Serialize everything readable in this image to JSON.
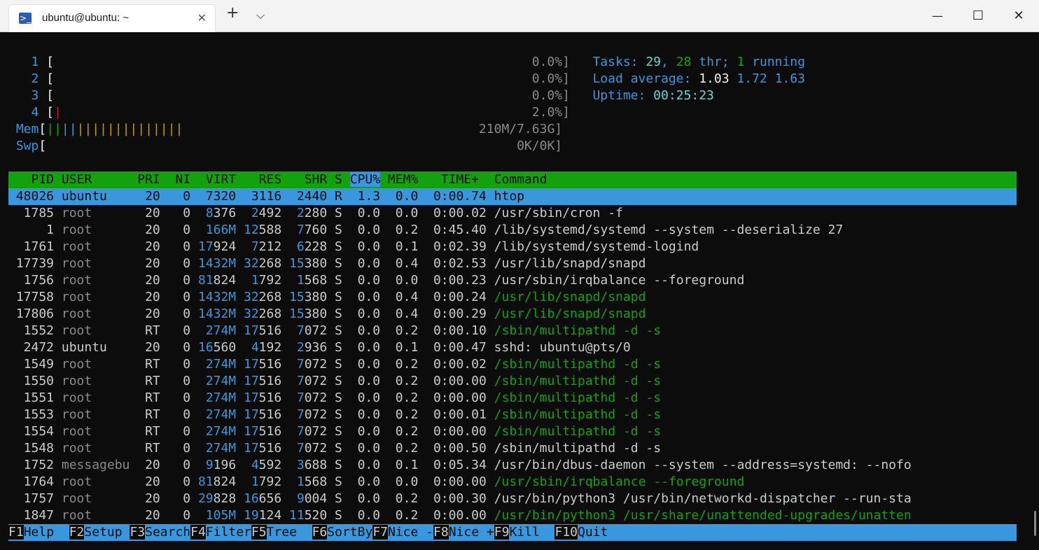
{
  "window": {
    "tab_title": "ubuntu@ubuntu: ~",
    "tab_icon": "powershell-icon",
    "new_tab": "+",
    "dropdown": "⌵",
    "close_tab": "✕",
    "minimize": "—",
    "maximize": "☐",
    "close": "✕"
  },
  "meters": {
    "cpu": [
      {
        "num": "1",
        "open": "[",
        "bar": "",
        "value": "0.0%]"
      },
      {
        "num": "2",
        "open": "[",
        "bar": "",
        "value": "0.0%]"
      },
      {
        "num": "3",
        "open": "[",
        "bar": "",
        "value": "0.0%]"
      },
      {
        "num": "4",
        "open": "[",
        "bar": "|",
        "value": "2.0%]"
      }
    ],
    "mem": {
      "label": "Mem",
      "open": "[",
      "bar_green": "||",
      "bar_blue": "||",
      "bar_yellow": "||||||||||||||",
      "value": "210M/7.63G]"
    },
    "swp": {
      "label": "Swp",
      "open": "[",
      "value": "0K/0K]"
    }
  },
  "summary": {
    "tasks_label": "Tasks:",
    "tasks_count": "29",
    "sep1": ",",
    "threads": "28",
    "thr_label": "thr;",
    "running": "1",
    "running_label": "running",
    "load_label": "Load average:",
    "load1": "1.03",
    "load5": "1.72",
    "load15": "1.63",
    "uptime_label": "Uptime:",
    "uptime": "00:25:23"
  },
  "header": {
    "pid": "  PID",
    "user": "USER     ",
    "pri": " PRI",
    "ni": "  NI",
    "virt": "  VIRT",
    "res": "   RES",
    "shr": "   SHR",
    "s": "S",
    "cpu": "CPU%",
    "mem": "MEM%",
    "time": "   TIME+ ",
    "command": "Command"
  },
  "processes": [
    {
      "pid": "48026",
      "user": "ubuntu",
      "pri": "20",
      "ni": "0",
      "virt": "7320",
      "res": "3116",
      "shr": "2440",
      "s": "R",
      "cpu": "1.3",
      "mem": "0.0",
      "time": "0:00.74",
      "cmd": "htop"
    },
    {
      "pid": "1785",
      "user": "root",
      "pri": "20",
      "ni": "0",
      "virt": "8376",
      "res": "2492",
      "shr": "2280",
      "s": "S",
      "cpu": "0.0",
      "mem": "0.0",
      "time": "0:00.02",
      "cmd": "/usr/sbin/cron -f"
    },
    {
      "pid": "1",
      "user": "root",
      "pri": "20",
      "ni": "0",
      "virt": "166M",
      "res": "12588",
      "shr": "7760",
      "s": "S",
      "cpu": "0.0",
      "mem": "0.2",
      "time": "0:45.40",
      "cmd": "/lib/systemd/systemd --system --deserialize 27"
    },
    {
      "pid": "1761",
      "user": "root",
      "pri": "20",
      "ni": "0",
      "virt": "17924",
      "res": "7212",
      "shr": "6228",
      "s": "S",
      "cpu": "0.0",
      "mem": "0.1",
      "time": "0:02.39",
      "cmd": "/lib/systemd/systemd-logind"
    },
    {
      "pid": "17739",
      "user": "root",
      "pri": "20",
      "ni": "0",
      "virt": "1432M",
      "res": "32268",
      "shr": "15380",
      "s": "S",
      "cpu": "0.0",
      "mem": "0.4",
      "time": "0:02.53",
      "cmd": "/usr/lib/snapd/snapd"
    },
    {
      "pid": "1756",
      "user": "root",
      "pri": "20",
      "ni": "0",
      "virt": "81824",
      "res": "1792",
      "shr": "1568",
      "s": "S",
      "cpu": "0.0",
      "mem": "0.0",
      "time": "0:00.23",
      "cmd": "/usr/sbin/irqbalance --foreground"
    },
    {
      "pid": "17758",
      "user": "root",
      "pri": "20",
      "ni": "0",
      "virt": "1432M",
      "res": "32268",
      "shr": "15380",
      "s": "S",
      "cpu": "0.0",
      "mem": "0.4",
      "time": "0:00.24",
      "cmd": "/usr/lib/snapd/snapd"
    },
    {
      "pid": "17806",
      "user": "root",
      "pri": "20",
      "ni": "0",
      "virt": "1432M",
      "res": "32268",
      "shr": "15380",
      "s": "S",
      "cpu": "0.0",
      "mem": "0.4",
      "time": "0:00.29",
      "cmd": "/usr/lib/snapd/snapd"
    },
    {
      "pid": "1552",
      "user": "root",
      "pri": "RT",
      "ni": "0",
      "virt": "274M",
      "res": "17516",
      "shr": "7072",
      "s": "S",
      "cpu": "0.0",
      "mem": "0.2",
      "time": "0:00.10",
      "cmd": "/sbin/multipathd -d -s"
    },
    {
      "pid": "2472",
      "user": "ubuntu",
      "pri": "20",
      "ni": "0",
      "virt": "16560",
      "res": "4192",
      "shr": "2936",
      "s": "S",
      "cpu": "0.0",
      "mem": "0.1",
      "time": "0:00.47",
      "cmd": "sshd: ubuntu@pts/0"
    },
    {
      "pid": "1549",
      "user": "root",
      "pri": "RT",
      "ni": "0",
      "virt": "274M",
      "res": "17516",
      "shr": "7072",
      "s": "S",
      "cpu": "0.0",
      "mem": "0.2",
      "time": "0:00.02",
      "cmd": "/sbin/multipathd -d -s"
    },
    {
      "pid": "1550",
      "user": "root",
      "pri": "RT",
      "ni": "0",
      "virt": "274M",
      "res": "17516",
      "shr": "7072",
      "s": "S",
      "cpu": "0.0",
      "mem": "0.2",
      "time": "0:00.00",
      "cmd": "/sbin/multipathd -d -s"
    },
    {
      "pid": "1551",
      "user": "root",
      "pri": "RT",
      "ni": "0",
      "virt": "274M",
      "res": "17516",
      "shr": "7072",
      "s": "S",
      "cpu": "0.0",
      "mem": "0.2",
      "time": "0:00.00",
      "cmd": "/sbin/multipathd -d -s"
    },
    {
      "pid": "1553",
      "user": "root",
      "pri": "RT",
      "ni": "0",
      "virt": "274M",
      "res": "17516",
      "shr": "7072",
      "s": "S",
      "cpu": "0.0",
      "mem": "0.2",
      "time": "0:00.01",
      "cmd": "/sbin/multipathd -d -s"
    },
    {
      "pid": "1554",
      "user": "root",
      "pri": "RT",
      "ni": "0",
      "virt": "274M",
      "res": "17516",
      "shr": "7072",
      "s": "S",
      "cpu": "0.0",
      "mem": "0.2",
      "time": "0:00.00",
      "cmd": "/sbin/multipathd -d -s"
    },
    {
      "pid": "1548",
      "user": "root",
      "pri": "RT",
      "ni": "0",
      "virt": "274M",
      "res": "17516",
      "shr": "7072",
      "s": "S",
      "cpu": "0.0",
      "mem": "0.2",
      "time": "0:00.50",
      "cmd": "/sbin/multipathd -d -s"
    },
    {
      "pid": "1752",
      "user": "messagebu",
      "pri": "20",
      "ni": "0",
      "virt": "9196",
      "res": "4592",
      "shr": "3688",
      "s": "S",
      "cpu": "0.0",
      "mem": "0.1",
      "time": "0:05.34",
      "cmd": "/usr/bin/dbus-daemon --system --address=systemd: --nofo"
    },
    {
      "pid": "1764",
      "user": "root",
      "pri": "20",
      "ni": "0",
      "virt": "81824",
      "res": "1792",
      "shr": "1568",
      "s": "S",
      "cpu": "0.0",
      "mem": "0.0",
      "time": "0:00.00",
      "cmd": "/usr/sbin/irqbalance --foreground"
    },
    {
      "pid": "1757",
      "user": "root",
      "pri": "20",
      "ni": "0",
      "virt": "29828",
      "res": "16656",
      "shr": "9004",
      "s": "S",
      "cpu": "0.0",
      "mem": "0.2",
      "time": "0:00.30",
      "cmd": "/usr/bin/python3 /usr/bin/networkd-dispatcher --run-sta"
    },
    {
      "pid": "1847",
      "user": "root",
      "pri": "20",
      "ni": "0",
      "virt": "105M",
      "res": "19124",
      "shr": "11520",
      "s": "S",
      "cpu": "0.0",
      "mem": "0.2",
      "time": "0:00.00",
      "cmd": "/usr/bin/python3 /usr/share/unattended-upgrades/unatten"
    }
  ],
  "fkeys": [
    {
      "key": "F1",
      "label": "Help  "
    },
    {
      "key": "F2",
      "label": "Setup "
    },
    {
      "key": "F3",
      "label": "Search"
    },
    {
      "key": "F4",
      "label": "Filter"
    },
    {
      "key": "F5",
      "label": "Tree  "
    },
    {
      "key": "F6",
      "label": "SortBy"
    },
    {
      "key": "F7",
      "label": "Nice -"
    },
    {
      "key": "F8",
      "label": "Nice +"
    },
    {
      "key": "F9",
      "label": "Kill  "
    },
    {
      "key": "F10",
      "label": "Quit"
    }
  ],
  "colors": {
    "terminal_bg": "#0c0c0c",
    "header_green": "#13a10e",
    "select_blue": "#3a96dd",
    "cyan": "#61d6d6"
  }
}
